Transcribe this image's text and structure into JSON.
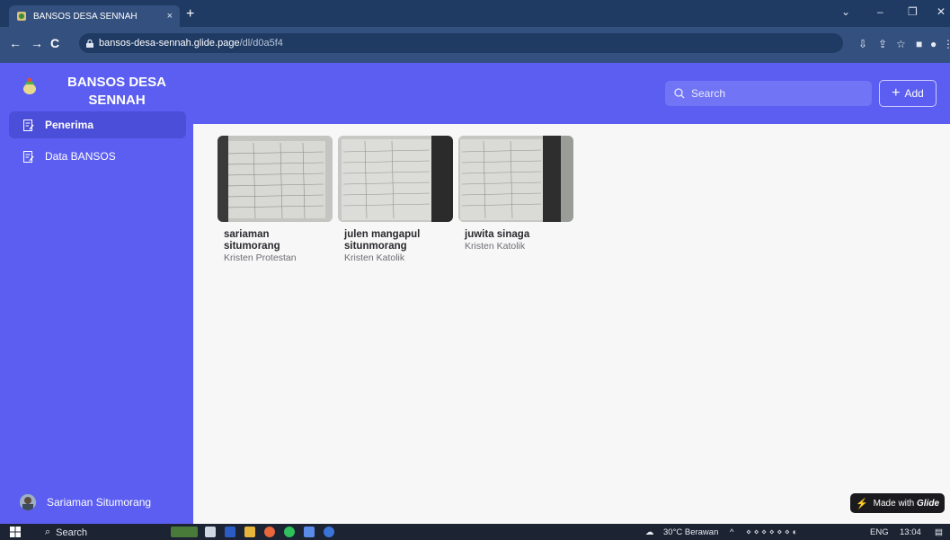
{
  "browser": {
    "tab_title": "BANSOS DESA SENNAH",
    "tab_close": "×",
    "new_tab": "+",
    "url_host": "bansos-desa-sennah.glide.page",
    "url_path": "/dl/d0a5f4"
  },
  "app": {
    "brand": "BANSOS DESA SENNAH",
    "search_placeholder": "Search",
    "add_label": "Add",
    "accent_color": "#5b5ef0"
  },
  "sidebar": {
    "items": [
      {
        "label": "Penerima",
        "active": true
      },
      {
        "label": "Data BANSOS",
        "active": false
      }
    ],
    "user_name": "Sariaman Situmorang"
  },
  "cards": [
    {
      "name": "sariaman situmorang",
      "religion": "Kristen Protestan"
    },
    {
      "name": "julen mangapul situnmorang",
      "religion": "Kristen Katolik"
    },
    {
      "name": "juwita sinaga",
      "religion": "Kristen Katolik"
    }
  ],
  "badge": {
    "made_with": "Made with",
    "brand": "Glide"
  },
  "taskbar": {
    "search": "Search",
    "weather": "30°C Berawan",
    "lang": "ENG",
    "time": "13:04"
  }
}
